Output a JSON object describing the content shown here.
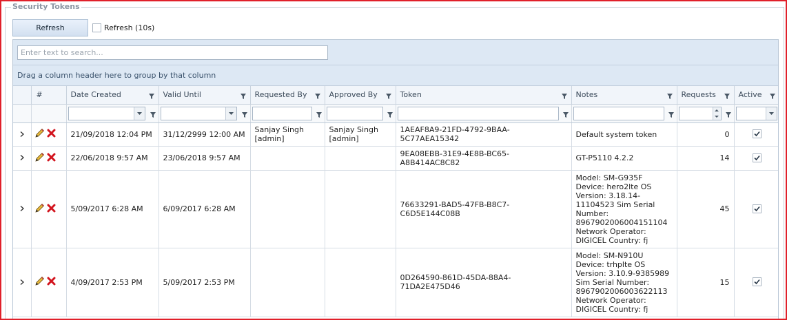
{
  "panel": {
    "title": "Security Tokens"
  },
  "toolbar": {
    "refresh_label": "Refresh",
    "auto_refresh_label": "Refresh (10s)",
    "auto_refresh_checked": false
  },
  "search": {
    "placeholder": "Enter text to search...",
    "value": ""
  },
  "group_panel": {
    "text": "Drag a column header here to group by that column"
  },
  "columns": {
    "number": "#",
    "date_created": "Date Created",
    "valid_until": "Valid Until",
    "requested_by": "Requested By",
    "approved_by": "Approved By",
    "token": "Token",
    "notes": "Notes",
    "requests": "Requests",
    "active": "Active"
  },
  "rows": [
    {
      "date_created": "21/09/2018 12:04 PM",
      "valid_until": "31/12/2999 12:00 AM",
      "requested_by": "Sanjay Singh [admin]",
      "approved_by": "Sanjay Singh [admin]",
      "token": "1AEAF8A9-21FD-4792-9BAA-5C77AEA15342",
      "notes": "Default system token",
      "requests": "0",
      "active": true
    },
    {
      "date_created": "22/06/2018 9:57 AM",
      "valid_until": "23/06/2018 9:57 AM",
      "requested_by": "",
      "approved_by": "",
      "token": "9EA08EBB-31E9-4E8B-BC65-A8B414AC8C82",
      "notes": "GT-P5110 4.2.2",
      "requests": "14",
      "active": true
    },
    {
      "date_created": "5/09/2017 6:28 AM",
      "valid_until": "6/09/2017 6:28 AM",
      "requested_by": "",
      "approved_by": "",
      "token": "76633291-BAD5-47FB-B8C7-C6D5E144C08B",
      "notes": "Model: SM-G935F Device: hero2lte OS Version: 3.18.14-11104523 Sim Serial Number: 8967902006004151104 Network Operator: DIGICEL Country: fj",
      "requests": "45",
      "active": true
    },
    {
      "date_created": "4/09/2017 2:53 PM",
      "valid_until": "5/09/2017 2:53 PM",
      "requested_by": "",
      "approved_by": "",
      "token": "0D264590-861D-45DA-88A4-71DA2E475D46",
      "notes": "Model: SM-N910U Device: trhplte OS Version: 3.10.9-9385989 Sim Serial Number: 8967902006003622113 Network Operator: DIGICEL Country: fj",
      "requests": "15",
      "active": true
    }
  ],
  "icons": {
    "expand": "chevron-right-icon",
    "edit": "pencil-icon",
    "delete": "delete-x-icon",
    "filter": "filter-icon"
  },
  "colors": {
    "frame_border": "#e0202a",
    "panel_title": "#8c96a3",
    "delete_red": "#d2141e",
    "header_bg": "#f1f5fa",
    "toolbar_bg": "#dde8f4"
  }
}
